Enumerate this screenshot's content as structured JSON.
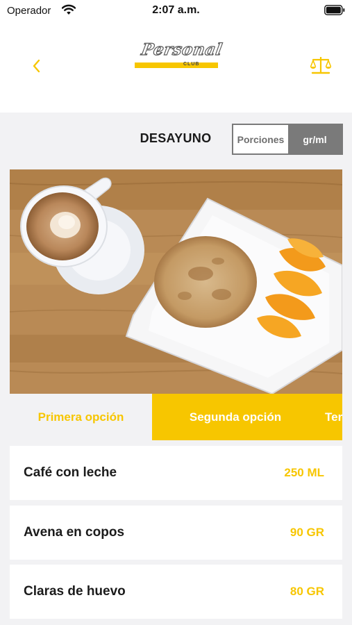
{
  "status_bar": {
    "carrier": "Operador",
    "time": "2:07 a.m."
  },
  "header": {
    "logo_text": "Personal",
    "logo_sub": "CLUB",
    "back_icon": "chevron-left-icon",
    "scale_icon": "scale-icon"
  },
  "meal": {
    "title": "DESAYUNO"
  },
  "unit_toggle": {
    "option_1": "Porciones",
    "option_2": "gr/ml",
    "selected": "gr/ml"
  },
  "tabs": [
    {
      "label": "Primera opción"
    },
    {
      "label": "Segunda opción"
    },
    {
      "label": "Ter"
    }
  ],
  "foods": [
    {
      "name": "Café con leche",
      "amount": "250 ML"
    },
    {
      "name": "Avena en copos",
      "amount": "90 GR"
    },
    {
      "name": "Claras de huevo",
      "amount": "80 GR"
    }
  ],
  "colors": {
    "accent": "#f7c600",
    "background": "#f2f2f4",
    "toggle_gray": "#7a7a7a"
  }
}
